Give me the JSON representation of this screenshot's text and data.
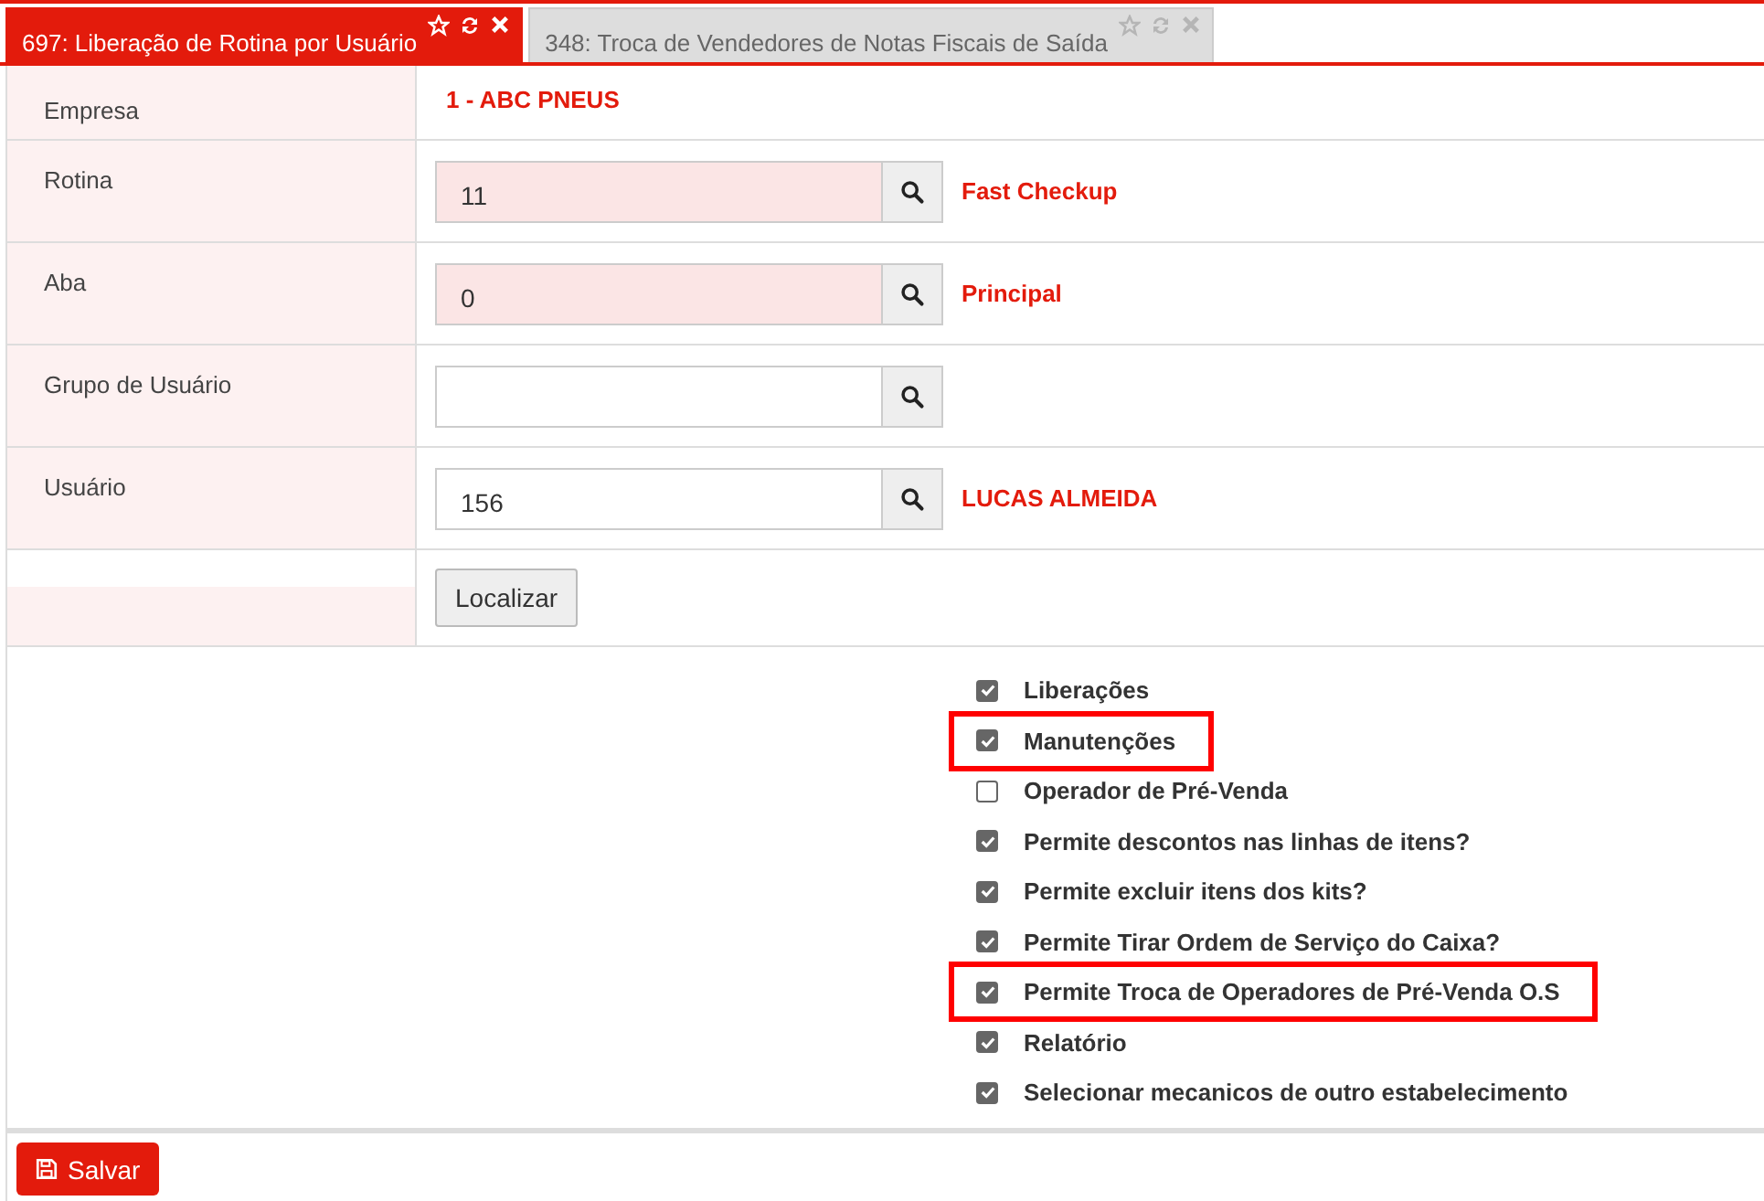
{
  "tabs": [
    {
      "label": "697: Liberação de Rotina por Usuário",
      "selected": true
    },
    {
      "label": "348: Troca de Vendedores de Notas Fiscais de Saída",
      "selected": false
    }
  ],
  "form": {
    "rows": [
      {
        "kind": "text",
        "label": "Empresa",
        "value": "1 - ABC PNEUS"
      },
      {
        "kind": "lookup",
        "label": "Rotina",
        "value": "11",
        "required": true,
        "description": "Fast Checkup"
      },
      {
        "kind": "lookup",
        "label": "Aba",
        "value": "0",
        "required": true,
        "description": "Principal"
      },
      {
        "kind": "lookup",
        "label": "Grupo de Usuário",
        "value": "",
        "required": false
      },
      {
        "kind": "lookup",
        "label": "Usuário",
        "value": "156",
        "required": false,
        "description": "LUCAS ALMEIDA"
      },
      {
        "kind": "button",
        "label": "Localizar"
      }
    ]
  },
  "permissions": [
    {
      "label": "Liberações",
      "checked": true,
      "highlighted": false
    },
    {
      "label": "Manutenções",
      "checked": true,
      "highlighted": true
    },
    {
      "label": "Operador de Pré-Venda",
      "checked": false,
      "highlighted": false
    },
    {
      "label": "Permite descontos nas linhas de itens?",
      "checked": true,
      "highlighted": false
    },
    {
      "label": "Permite excluir itens dos kits?",
      "checked": true,
      "highlighted": false
    },
    {
      "label": "Permite Tirar Ordem de Serviço do Caixa?",
      "checked": true,
      "highlighted": false
    },
    {
      "label": "Permite Troca de Operadores de Pré-Venda O.S",
      "checked": true,
      "highlighted": true
    },
    {
      "label": "Relatório",
      "checked": true,
      "highlighted": false
    },
    {
      "label": "Selecionar mecanicos de outro estabelecimento",
      "checked": true,
      "highlighted": false
    }
  ],
  "footer": {
    "save_button": "Salvar"
  }
}
